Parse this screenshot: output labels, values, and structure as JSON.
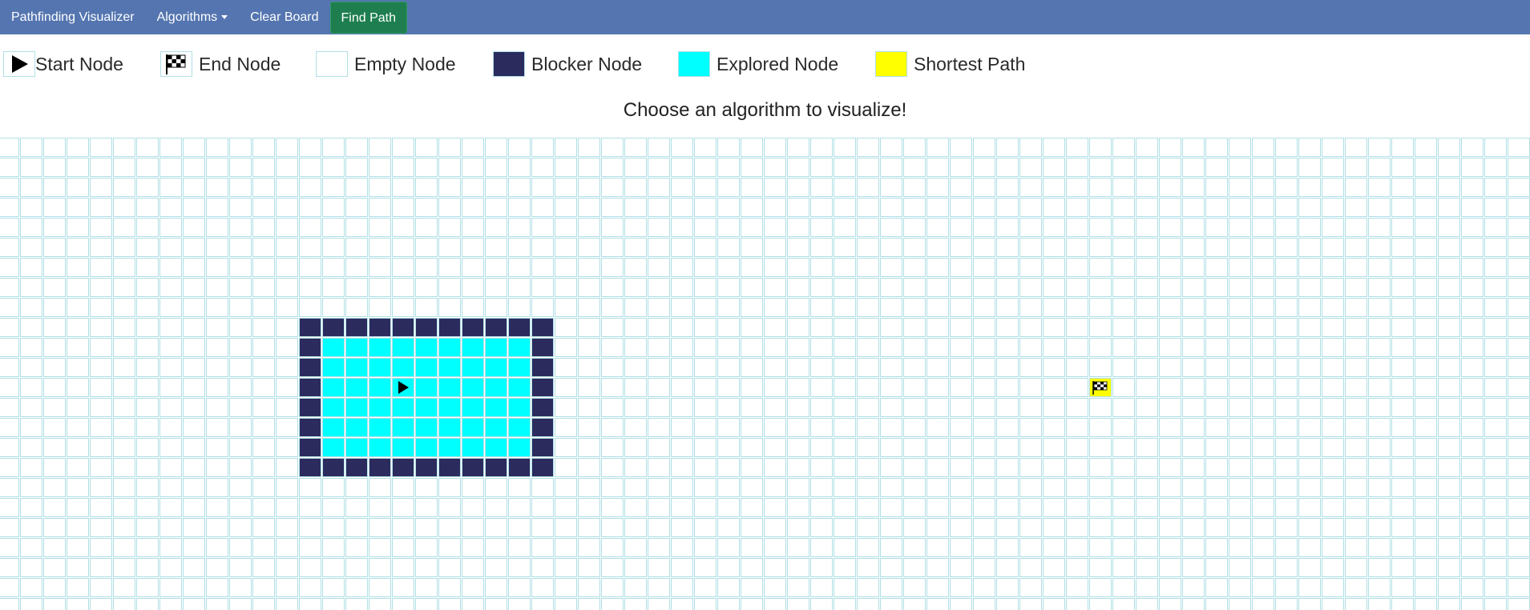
{
  "navbar": {
    "brand": "Pathfinding Visualizer",
    "algorithms_label": "Algorithms",
    "clear_label": "Clear Board",
    "find_label": "Find Path"
  },
  "legend": {
    "start": "Start Node",
    "end": "End Node",
    "empty": "Empty Node",
    "blocker": "Blocker Node",
    "explored": "Explored Node",
    "shortest": "Shortest Path"
  },
  "message": "Choose an algorithm to visualize!",
  "colors": {
    "navbar": "#5475b0",
    "find_button": "#1e7e4f",
    "blocker": "#2b2b5e",
    "explored": "#00ffff",
    "shortest": "#ffff00",
    "cell_border": "#b0dfe5"
  },
  "grid": {
    "start": [
      12,
      17
    ],
    "end": [
      12,
      47
    ],
    "path_nodes": [
      [
        12,
        47
      ]
    ],
    "walls": {
      "rect": {
        "row_start": 9,
        "row_end": 16,
        "col_start": 13,
        "col_end": 23
      }
    },
    "explored": {
      "rect": {
        "row_start": 10,
        "row_end": 15,
        "col_start": 14,
        "col_end": 22
      }
    }
  }
}
